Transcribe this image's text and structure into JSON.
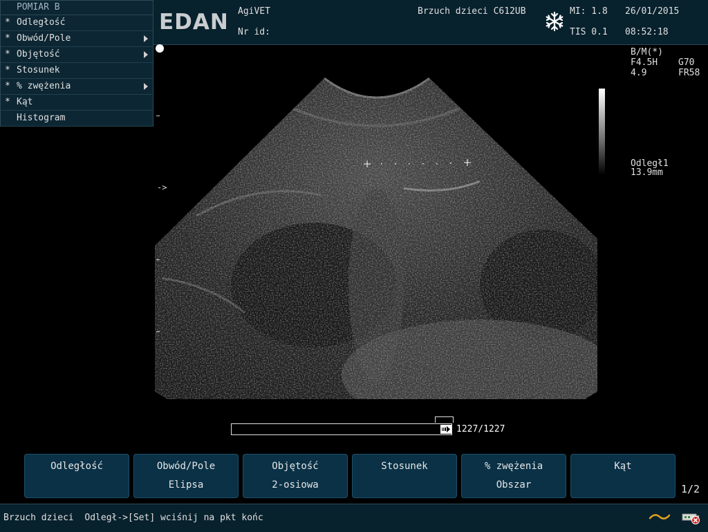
{
  "menu": {
    "title": "POMIAR B",
    "items": [
      {
        "star": "*",
        "label": "Odległość",
        "has_submenu": false
      },
      {
        "star": "*",
        "label": "Obwód/Pole",
        "has_submenu": true
      },
      {
        "star": "*",
        "label": "Objętość",
        "has_submenu": true
      },
      {
        "star": "*",
        "label": "Stosunek",
        "has_submenu": false
      },
      {
        "star": "*",
        "label": "% zwężenia",
        "has_submenu": true
      },
      {
        "star": "*",
        "label": "Kąt",
        "has_submenu": false
      },
      {
        "star": "",
        "label": "Histogram",
        "has_submenu": false
      }
    ]
  },
  "header": {
    "logo": "EDAN",
    "hospital": "AgiVET",
    "id_label": "Nr id:",
    "exam": "Brzuch dzieci C612UB",
    "freeze_icon": "snowflake-icon",
    "mi": "MI: 1.8",
    "tis": "TIS 0.1",
    "date": "26/01/2015",
    "time": "08:52:18"
  },
  "image_info": {
    "mode": "B/M(*)",
    "freq": "F4.5H",
    "gain": "G70",
    "depth": "4.9",
    "frame_rate": "FR58",
    "measure_label": "Odległ1",
    "measure_value": "13.9mm",
    "focus_marker": "->"
  },
  "cine": {
    "count": "1227/1227",
    "progress": 1.0
  },
  "softkeys": [
    {
      "line1": "Odległość",
      "line2": ""
    },
    {
      "line1": "Obwód/Pole",
      "line2": "Elipsa"
    },
    {
      "line1": "Objętość",
      "line2": "2-osiowa"
    },
    {
      "line1": "Stosunek",
      "line2": ""
    },
    {
      "line1": "% zwężenia",
      "line2": "Obszar"
    },
    {
      "line1": "Kąt",
      "line2": ""
    }
  ],
  "page_indicator": "1/2",
  "status": {
    "text": "Brzuch dzieci  Odległ->[Set] wciśnij na pkt końc",
    "wave_icon": "wave-icon",
    "usb_icon": "usb-disconnected-icon"
  },
  "colors": {
    "panel_bg": "#07212d",
    "softkey_bg": "#0a3146",
    "text": "#e0e0e0"
  }
}
